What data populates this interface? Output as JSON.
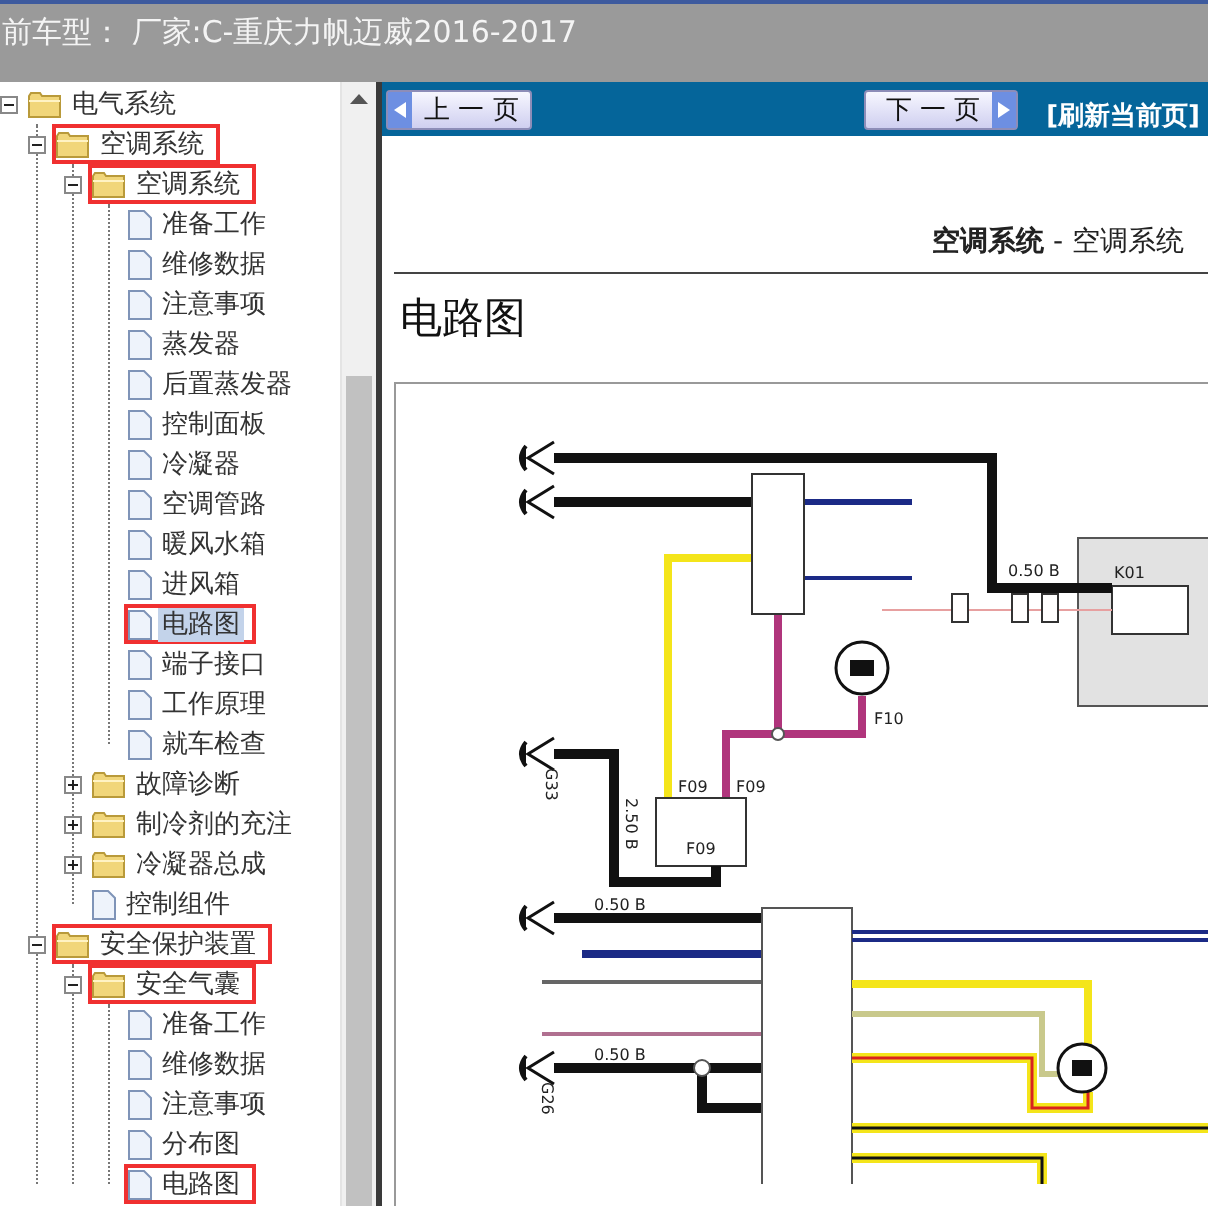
{
  "header": {
    "title": "前车型：  厂家:C-重庆力帆迈威2016-2017"
  },
  "tree": {
    "items": [
      {
        "label": "电气系统",
        "kind": "folder",
        "expanded": true,
        "selected": false,
        "highlighted": false,
        "children": [
          {
            "label": "空调系统",
            "kind": "folder",
            "expanded": true,
            "selected": false,
            "highlighted": true,
            "children": [
              {
                "label": "空调系统",
                "kind": "folder",
                "expanded": true,
                "selected": false,
                "highlighted": true,
                "children": [
                  {
                    "label": "准备工作",
                    "kind": "page",
                    "selected": false,
                    "highlighted": false
                  },
                  {
                    "label": "维修数据",
                    "kind": "page",
                    "selected": false,
                    "highlighted": false
                  },
                  {
                    "label": "注意事项",
                    "kind": "page",
                    "selected": false,
                    "highlighted": false
                  },
                  {
                    "label": "蒸发器",
                    "kind": "page",
                    "selected": false,
                    "highlighted": false
                  },
                  {
                    "label": "后置蒸发器",
                    "kind": "page",
                    "selected": false,
                    "highlighted": false
                  },
                  {
                    "label": "控制面板",
                    "kind": "page",
                    "selected": false,
                    "highlighted": false
                  },
                  {
                    "label": "冷凝器",
                    "kind": "page",
                    "selected": false,
                    "highlighted": false
                  },
                  {
                    "label": "空调管路",
                    "kind": "page",
                    "selected": false,
                    "highlighted": false
                  },
                  {
                    "label": "暖风水箱",
                    "kind": "page",
                    "selected": false,
                    "highlighted": false
                  },
                  {
                    "label": "进风箱",
                    "kind": "page",
                    "selected": false,
                    "highlighted": false
                  },
                  {
                    "label": "电路图",
                    "kind": "page",
                    "selected": true,
                    "highlighted": true
                  },
                  {
                    "label": "端子接口",
                    "kind": "page",
                    "selected": false,
                    "highlighted": false
                  },
                  {
                    "label": "工作原理",
                    "kind": "page",
                    "selected": false,
                    "highlighted": false
                  },
                  {
                    "label": "就车检查",
                    "kind": "page",
                    "selected": false,
                    "highlighted": false
                  }
                ]
              },
              {
                "label": "故障诊断",
                "kind": "folder",
                "expanded": false,
                "selected": false,
                "highlighted": false
              },
              {
                "label": "制冷剂的充注",
                "kind": "folder",
                "expanded": false,
                "selected": false,
                "highlighted": false
              },
              {
                "label": "冷凝器总成",
                "kind": "folder",
                "expanded": false,
                "selected": false,
                "highlighted": false
              },
              {
                "label": "控制组件",
                "kind": "page",
                "selected": false,
                "highlighted": false
              }
            ]
          },
          {
            "label": "安全保护装置",
            "kind": "folder",
            "expanded": true,
            "selected": false,
            "highlighted": true,
            "children": [
              {
                "label": "安全气囊",
                "kind": "folder",
                "expanded": true,
                "selected": false,
                "highlighted": true,
                "children": [
                  {
                    "label": "准备工作",
                    "kind": "page",
                    "selected": false,
                    "highlighted": false
                  },
                  {
                    "label": "维修数据",
                    "kind": "page",
                    "selected": false,
                    "highlighted": false
                  },
                  {
                    "label": "注意事项",
                    "kind": "page",
                    "selected": false,
                    "highlighted": false
                  },
                  {
                    "label": "分布图",
                    "kind": "page",
                    "selected": false,
                    "highlighted": false
                  },
                  {
                    "label": "电路图",
                    "kind": "page",
                    "selected": false,
                    "highlighted": true
                  }
                ]
              }
            ]
          }
        ]
      }
    ]
  },
  "toolbar": {
    "prev": "上 一 页",
    "next": "下 一 页",
    "refresh": "[刷新当前页]"
  },
  "document": {
    "running_head": "**空调系统** - 空调系统",
    "heading": "电路图",
    "diagram_labels": [
      "0.50 B",
      "K01",
      "F10",
      "F09",
      "F09",
      "F09",
      "2.50 B",
      "G33",
      "0.50 B",
      "0.50 B",
      "G26"
    ]
  }
}
